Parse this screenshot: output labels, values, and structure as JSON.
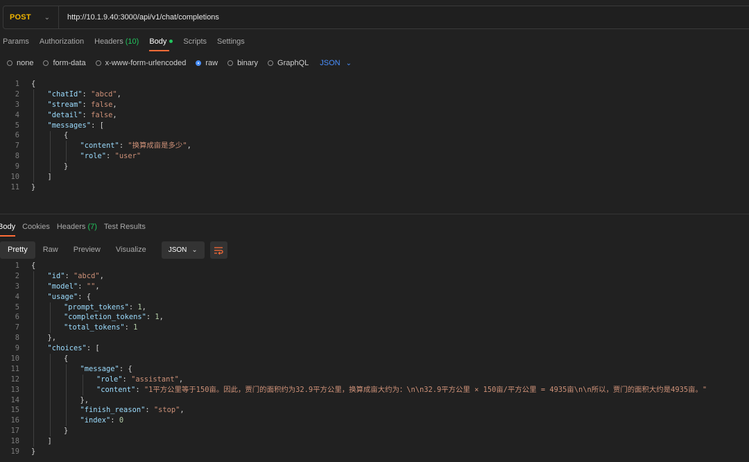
{
  "request": {
    "method": "POST",
    "url": "http://10.1.9.40:3000/api/v1/chat/completions",
    "tabs": [
      {
        "label": "Params"
      },
      {
        "label": "Authorization"
      },
      {
        "label": "Headers",
        "count": "(10)"
      },
      {
        "label": "Body"
      },
      {
        "label": "Scripts"
      },
      {
        "label": "Settings"
      }
    ],
    "body_types": [
      "none",
      "form-data",
      "x-www-form-urlencoded",
      "raw",
      "binary",
      "GraphQL"
    ],
    "body_format": "JSON"
  },
  "request_body_lines": [
    [
      {
        "t": "b",
        "v": "{"
      }
    ],
    [
      {
        "t": "k",
        "v": "\"chatId\""
      },
      {
        "t": "b",
        "v": ": "
      },
      {
        "t": "s",
        "v": "\"abcd\""
      },
      {
        "t": "b",
        "v": ","
      }
    ],
    [
      {
        "t": "k",
        "v": "\"stream\""
      },
      {
        "t": "b",
        "v": ": "
      },
      {
        "t": "s",
        "v": "false"
      },
      {
        "t": "b",
        "v": ","
      }
    ],
    [
      {
        "t": "k",
        "v": "\"detail\""
      },
      {
        "t": "b",
        "v": ": "
      },
      {
        "t": "s",
        "v": "false"
      },
      {
        "t": "b",
        "v": ","
      }
    ],
    [
      {
        "t": "k",
        "v": "\"messages\""
      },
      {
        "t": "b",
        "v": ": ["
      }
    ],
    [
      {
        "t": "b",
        "v": "{"
      }
    ],
    [
      {
        "t": "k",
        "v": "\"content\""
      },
      {
        "t": "b",
        "v": ": "
      },
      {
        "t": "s",
        "v": "\"换算成亩是多少\""
      },
      {
        "t": "b",
        "v": ","
      }
    ],
    [
      {
        "t": "k",
        "v": "\"role\""
      },
      {
        "t": "b",
        "v": ": "
      },
      {
        "t": "s",
        "v": "\"user\""
      }
    ],
    [
      {
        "t": "b",
        "v": "}"
      }
    ],
    [
      {
        "t": "b",
        "v": "]"
      }
    ],
    [
      {
        "t": "b",
        "v": "}"
      }
    ]
  ],
  "response": {
    "tabs": [
      {
        "label": "Body"
      },
      {
        "label": "Cookies"
      },
      {
        "label": "Headers",
        "count": "(7)"
      },
      {
        "label": "Test Results"
      }
    ],
    "views": [
      "Pretty",
      "Raw",
      "Preview",
      "Visualize"
    ],
    "format": "JSON"
  },
  "response_body_lines": [
    [
      {
        "t": "b",
        "v": "{"
      }
    ],
    [
      {
        "t": "k",
        "v": "\"id\""
      },
      {
        "t": "b",
        "v": ": "
      },
      {
        "t": "s",
        "v": "\"abcd\""
      },
      {
        "t": "b",
        "v": ","
      }
    ],
    [
      {
        "t": "k",
        "v": "\"model\""
      },
      {
        "t": "b",
        "v": ": "
      },
      {
        "t": "s",
        "v": "\"\""
      },
      {
        "t": "b",
        "v": ","
      }
    ],
    [
      {
        "t": "k",
        "v": "\"usage\""
      },
      {
        "t": "b",
        "v": ": {"
      }
    ],
    [
      {
        "t": "k",
        "v": "\"prompt_tokens\""
      },
      {
        "t": "b",
        "v": ": "
      },
      {
        "t": "n",
        "v": "1"
      },
      {
        "t": "b",
        "v": ","
      }
    ],
    [
      {
        "t": "k",
        "v": "\"completion_tokens\""
      },
      {
        "t": "b",
        "v": ": "
      },
      {
        "t": "n",
        "v": "1"
      },
      {
        "t": "b",
        "v": ","
      }
    ],
    [
      {
        "t": "k",
        "v": "\"total_tokens\""
      },
      {
        "t": "b",
        "v": ": "
      },
      {
        "t": "n",
        "v": "1"
      }
    ],
    [
      {
        "t": "b",
        "v": "},"
      }
    ],
    [
      {
        "t": "k",
        "v": "\"choices\""
      },
      {
        "t": "b",
        "v": ": ["
      }
    ],
    [
      {
        "t": "b",
        "v": "{"
      }
    ],
    [
      {
        "t": "k",
        "v": "\"message\""
      },
      {
        "t": "b",
        "v": ": {"
      }
    ],
    [
      {
        "t": "k",
        "v": "\"role\""
      },
      {
        "t": "b",
        "v": ": "
      },
      {
        "t": "s",
        "v": "\"assistant\""
      },
      {
        "t": "b",
        "v": ","
      }
    ],
    [
      {
        "t": "k",
        "v": "\"content\""
      },
      {
        "t": "b",
        "v": ": "
      },
      {
        "t": "s",
        "v": "\"1平方公里等于150亩。因此，贾门的面积约为32.9平方公里，换算成亩大约为：\\n\\n32.9平方公里 × 150亩/平方公里 = 4935亩\\n\\n所以，贾门的面积大约是4935亩。\""
      }
    ],
    [
      {
        "t": "b",
        "v": "},"
      }
    ],
    [
      {
        "t": "k",
        "v": "\"finish_reason\""
      },
      {
        "t": "b",
        "v": ": "
      },
      {
        "t": "s",
        "v": "\"stop\""
      },
      {
        "t": "b",
        "v": ","
      }
    ],
    [
      {
        "t": "k",
        "v": "\"index\""
      },
      {
        "t": "b",
        "v": ": "
      },
      {
        "t": "n",
        "v": "0"
      }
    ],
    [
      {
        "t": "b",
        "v": "}"
      }
    ],
    [
      {
        "t": "b",
        "v": "]"
      }
    ],
    [
      {
        "t": "b",
        "v": "}"
      }
    ]
  ],
  "colors": {
    "background": "#212121",
    "method": "#f0b400",
    "accent_tab": "#ff6c37",
    "count_green": "#22c55e",
    "selected_radio": "#4a90ff",
    "json_key": "#9cdcfe",
    "json_string": "#ce9178"
  },
  "icons": {
    "method_dropdown": "chevron-down-icon",
    "format_dropdown": "chevron-down-icon",
    "wrap": "wrap-lines-icon"
  }
}
